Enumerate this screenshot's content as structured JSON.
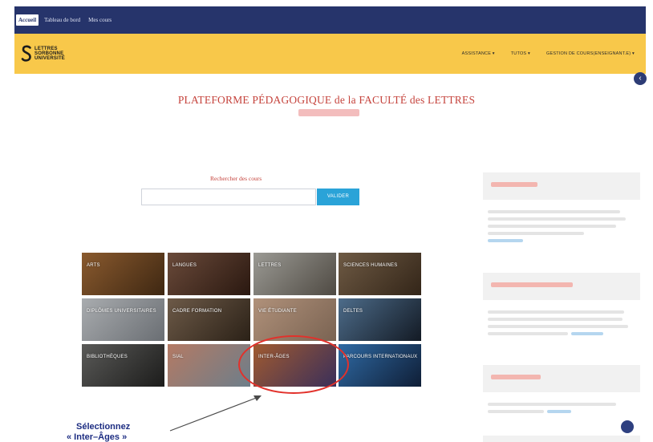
{
  "topbar": {
    "tabs": [
      {
        "label": "Accueil"
      },
      {
        "label": "Tableau de bord"
      },
      {
        "label": "Mes cours"
      }
    ]
  },
  "brand": {
    "logo_lines": [
      "LETTRES",
      "SORBONNE",
      "UNIVERSITÉ"
    ],
    "nav": [
      "ASSISTANCE ▾",
      "TUTOS ▾",
      "GESTION DE COURS(ENSEIGNANT.E) ▾"
    ]
  },
  "drawer_button": {
    "icon": "chevron-left-icon",
    "glyph": "‹"
  },
  "page": {
    "title": "PLATEFORME PÉDAGOGIQUE de la FACULTÉ des LETTRES"
  },
  "search": {
    "label": "Rechercher des cours",
    "placeholder": "",
    "button": "VALIDER"
  },
  "courses": [
    {
      "label": "ARTS",
      "colors": [
        "#8a5a2e",
        "#3e2712"
      ]
    },
    {
      "label": "LANGUES",
      "colors": [
        "#6a4a3a",
        "#2a1810"
      ]
    },
    {
      "label": "LETTRES",
      "colors": [
        "#9b9a94",
        "#4f4a43"
      ]
    },
    {
      "label": "SCIENCES HUMAINES",
      "colors": [
        "#6e5a44",
        "#332518"
      ]
    },
    {
      "label": "DIPLÔMES UNIVERSITAIRES",
      "colors": [
        "#a9acaf",
        "#6a6e73"
      ]
    },
    {
      "label": "CADRE FORMATION",
      "colors": [
        "#6d5a48",
        "#2b2117"
      ]
    },
    {
      "label": "VIE ÉTUDIANTE",
      "colors": [
        "#b0917a",
        "#7a6352"
      ]
    },
    {
      "label": "DELTES",
      "colors": [
        "#4d6c8a",
        "#131a24"
      ]
    },
    {
      "label": "BIBLIOTHÈQUES",
      "colors": [
        "#5a5a58",
        "#1c1c1b"
      ]
    },
    {
      "label": "SIAL",
      "colors": [
        "#b47a64",
        "#6d7e8a"
      ]
    },
    {
      "label": "INTER-ÂGES",
      "colors": [
        "#a05a30",
        "#3a2f5a"
      ]
    },
    {
      "label": "PARCOURS INTERNATIONAUX",
      "colors": [
        "#2f6aa4",
        "#0f1e36"
      ]
    }
  ],
  "annotation": {
    "line1": "Sélectionnez",
    "line2": "« Inter–Âges »"
  },
  "colors": {
    "navy": "#26346b",
    "yellow": "#f8c84a",
    "title_red": "#c5433c",
    "button_blue": "#2aa3d8",
    "highlight_red": "#e2312b",
    "callout_blue": "#1d2d82"
  }
}
